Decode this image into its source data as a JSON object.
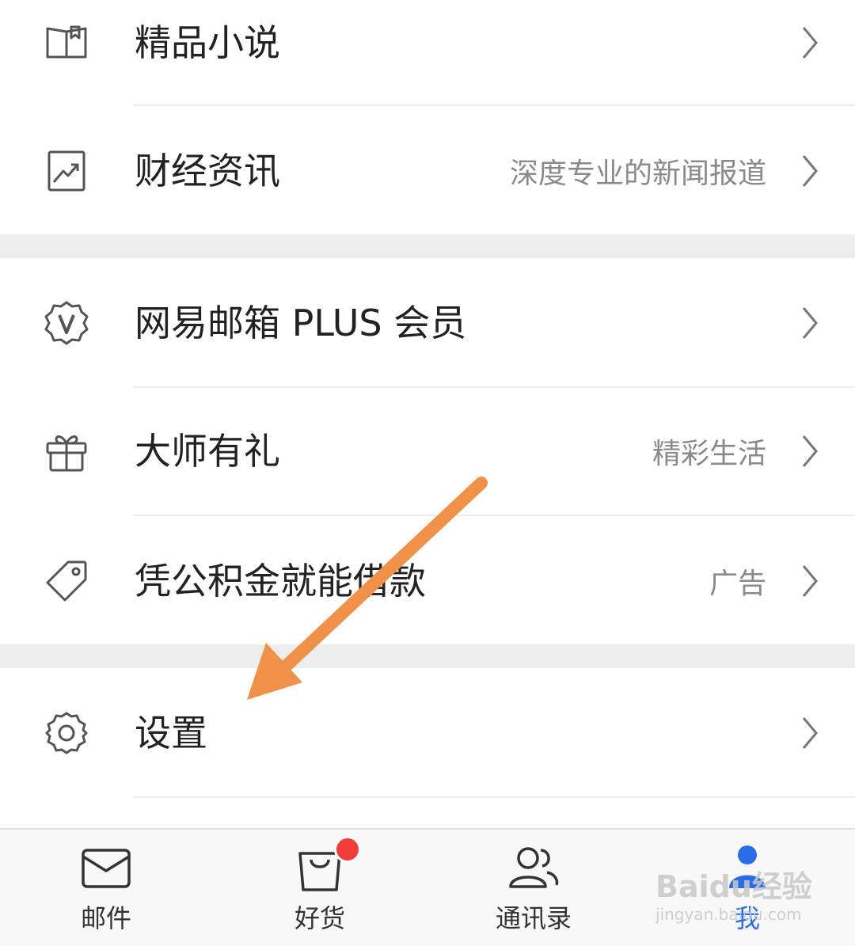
{
  "menu": {
    "section1": [
      {
        "label": "精品小说",
        "sub": "",
        "icon": "book-icon"
      },
      {
        "label": "财经资讯",
        "sub": "深度专业的新闻报道",
        "icon": "chart-trend-icon"
      }
    ],
    "section2": [
      {
        "label": "网易邮箱 PLUS 会员",
        "sub": "",
        "icon": "vip-badge-icon"
      },
      {
        "label": "大师有礼",
        "sub": "精彩生活",
        "icon": "gift-icon"
      },
      {
        "label": "凭公积金就能借款",
        "sub": "广告",
        "icon": "tag-icon"
      }
    ],
    "section3": [
      {
        "label": "设置",
        "sub": "",
        "icon": "gear-icon"
      }
    ]
  },
  "tabbar": {
    "tabs": [
      {
        "label": "邮件",
        "icon": "mail-icon",
        "active": false
      },
      {
        "label": "好货",
        "icon": "shopping-bag-icon",
        "active": false,
        "badge": true
      },
      {
        "label": "通讯录",
        "icon": "contacts-icon",
        "active": false
      },
      {
        "label": "我",
        "icon": "profile-icon",
        "active": true
      }
    ]
  },
  "colors": {
    "accent": "#2b6de6",
    "badge": "#f23b3b",
    "annotation_arrow": "#f0914a",
    "section_gap": "#ededed"
  },
  "watermark": {
    "main": "Baidu经验",
    "url": "jingyan.baidu.com"
  }
}
